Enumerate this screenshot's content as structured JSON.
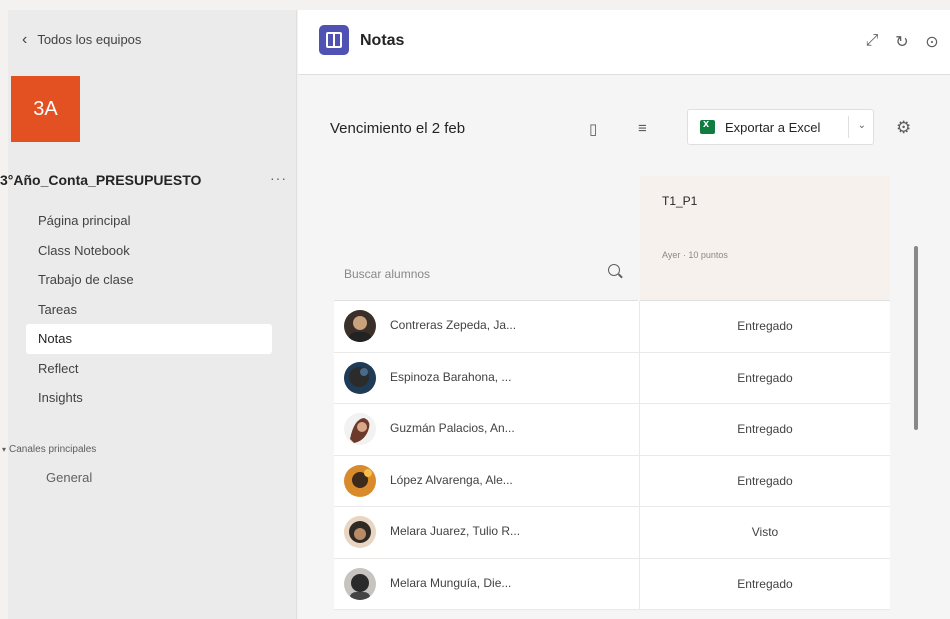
{
  "sidebar": {
    "back_label": "Todos los equipos",
    "team_initials": "3A",
    "team_name": "3°Año_Conta_PRESUPUESTO",
    "more_label": "···",
    "items": [
      {
        "label": "Página principal"
      },
      {
        "label": "Class Notebook"
      },
      {
        "label": "Trabajo de clase"
      },
      {
        "label": "Tareas"
      },
      {
        "label": "Notas"
      },
      {
        "label": "Reflect"
      },
      {
        "label": "Insights"
      }
    ],
    "active_item": "Notas",
    "channels_header": "Canales principales",
    "channels": [
      {
        "label": "General"
      }
    ]
  },
  "header": {
    "app_title": "Notas",
    "icons": [
      "expand-icon",
      "refresh-icon",
      "info-icon"
    ]
  },
  "toolbar": {
    "due_label": "Vencimiento el 2 feb",
    "export_label": "Exportar a Excel"
  },
  "grades": {
    "search_placeholder": "Buscar alumnos",
    "assignment": {
      "title": "T1_P1",
      "meta": "Ayer · 10 puntos"
    },
    "students": [
      {
        "name": "Contreras Zepeda, Ja...",
        "status": "Entregado",
        "avatar_bg": "#3b2f2a",
        "avatar_fg": "#c9a27e"
      },
      {
        "name": "Espinoza Barahona, ...",
        "status": "Entregado",
        "avatar_bg": "#1f3b55",
        "avatar_fg": "#2b2b2b"
      },
      {
        "name": "Guzmán Palacios, An...",
        "status": "Entregado",
        "avatar_bg": "#f2f2f2",
        "avatar_fg": "#6b3a2a"
      },
      {
        "name": "López Alvarenga, Ale...",
        "status": "Entregado",
        "avatar_bg": "#d98b2b",
        "avatar_fg": "#3c2a1d"
      },
      {
        "name": "Melara Juarez, Tulio R...",
        "status": "Visto",
        "avatar_bg": "#e8d6c2",
        "avatar_fg": "#2f2a26"
      },
      {
        "name": "Melara Munguía, Die...",
        "status": "Entregado",
        "avatar_bg": "#c7c3bf",
        "avatar_fg": "#2a2a2a"
      }
    ]
  },
  "colors": {
    "team_tile": "#e35123",
    "app_icon": "#4f52b2",
    "excel": "#107c41"
  }
}
